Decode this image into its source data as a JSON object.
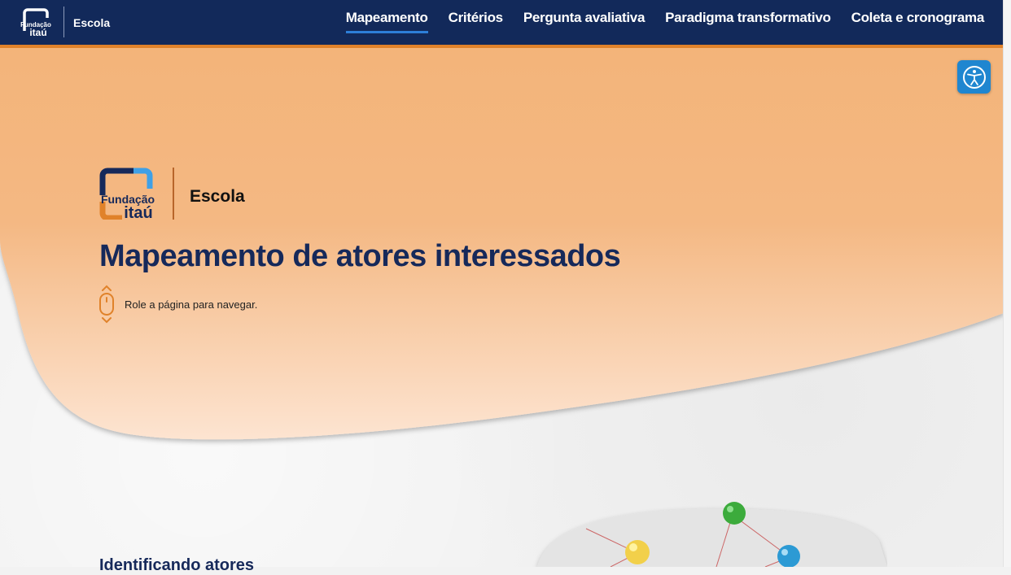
{
  "nav": {
    "logo_icon": "fundacao-itau-logo",
    "brand": "Escola",
    "links": [
      {
        "label": "Mapeamento",
        "active": true
      },
      {
        "label": "Critérios"
      },
      {
        "label": "Pergunta avaliativa"
      },
      {
        "label": "Paradigma transformativo"
      },
      {
        "label": "Coleta e cronograma"
      }
    ]
  },
  "accessibility_button": {
    "icon": "accessibility-icon",
    "color": "#1f86d0"
  },
  "hero": {
    "logo_text_top": "Fundação",
    "logo_text_bottom": "itaú",
    "brand": "Escola",
    "title": "Mapeamento de atores interessados",
    "scroll_hint": "Role a página para navegar.",
    "scroll_icon": "mouse-scroll-icon"
  },
  "section": {
    "heading_partial": "Identificando atores"
  },
  "colors": {
    "nav_bg": "#12295a",
    "accent_orange": "#e0822a",
    "blob_top": "#f3b479",
    "blob_bottom": "#fde3cf",
    "title": "#16295a"
  }
}
